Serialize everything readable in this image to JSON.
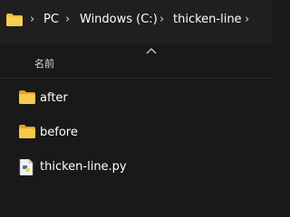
{
  "breadcrumb": {
    "items": [
      "PC",
      "Windows (C:)",
      "thicken-line"
    ]
  },
  "column_header": {
    "name_label": "名前"
  },
  "files": [
    {
      "name": "after",
      "type": "folder"
    },
    {
      "name": "before",
      "type": "folder"
    },
    {
      "name": "thicken-line.py",
      "type": "python-file"
    }
  ],
  "icons": {
    "folder": "folder-icon",
    "python_file": "python-file-icon",
    "separator": "chevron-right-icon",
    "sort": "sort-caret-icon"
  },
  "colors": {
    "background": "#191919",
    "address_bar": "#1f1f1f",
    "folder_yellow": "#f5c040",
    "text": "#ffffff"
  }
}
